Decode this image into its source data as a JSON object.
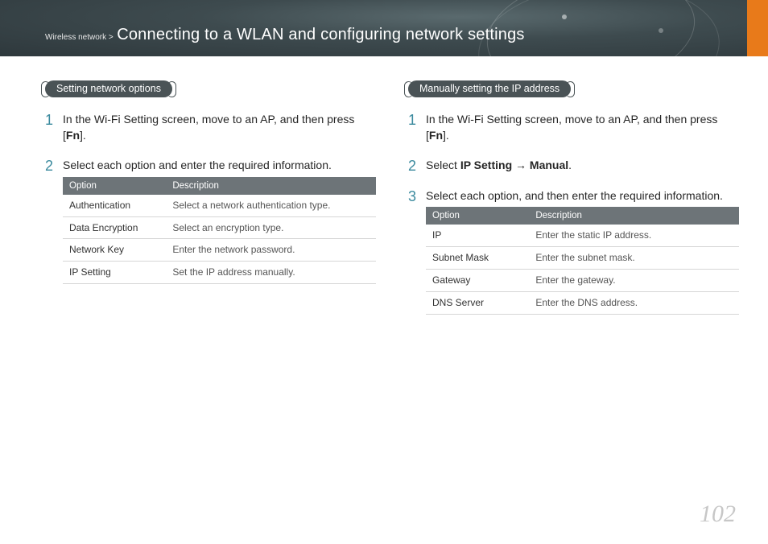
{
  "breadcrumb": {
    "section": "Wireless network >",
    "title": "Connecting to a WLAN and configuring network settings"
  },
  "left": {
    "heading": "Setting network options",
    "steps": {
      "s1_pre": "In the Wi-Fi Setting screen, move to an AP, and then press [",
      "s1_key": "Fn",
      "s1_post": "].",
      "s2": "Select each option and enter the required information."
    },
    "table": {
      "h1": "Option",
      "h2": "Description",
      "rows": [
        {
          "opt": "Authentication",
          "desc": "Select a network authentication type."
        },
        {
          "opt": "Data Encryption",
          "desc": "Select an encryption type."
        },
        {
          "opt": "Network Key",
          "desc": "Enter the network password."
        },
        {
          "opt": "IP Setting",
          "desc": "Set the IP address manually."
        }
      ]
    }
  },
  "right": {
    "heading": "Manually setting the IP address",
    "steps": {
      "s1_pre": "In the Wi-Fi Setting screen, move to an AP, and then press [",
      "s1_key": "Fn",
      "s1_post": "].",
      "s2_pre": "Select ",
      "s2_b1": "IP Setting",
      "s2_arrow": " → ",
      "s2_b2": "Manual",
      "s2_post": ".",
      "s3": "Select each option, and then enter the required information."
    },
    "table": {
      "h1": "Option",
      "h2": "Description",
      "rows": [
        {
          "opt": "IP",
          "desc": "Enter the static IP address."
        },
        {
          "opt": "Subnet Mask",
          "desc": "Enter the subnet mask."
        },
        {
          "opt": "Gateway",
          "desc": "Enter the gateway."
        },
        {
          "opt": "DNS Server",
          "desc": "Enter the DNS address."
        }
      ]
    }
  },
  "page_number": "102"
}
